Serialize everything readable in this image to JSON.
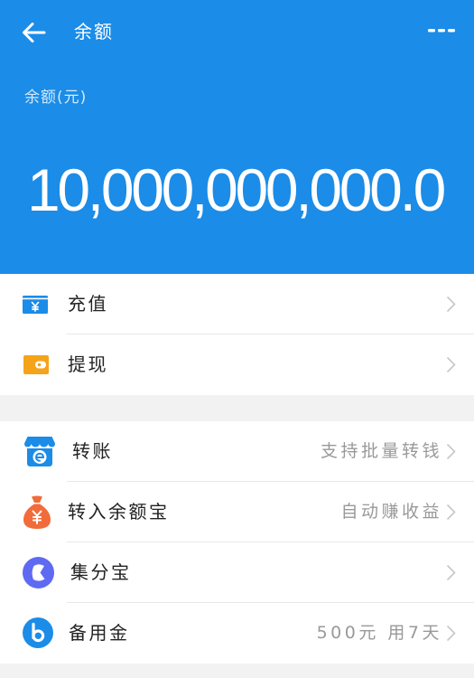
{
  "colors": {
    "primary": "#1B8CE7",
    "page_background": "#F2F2F2",
    "hint_text": "#999999"
  },
  "header": {
    "back_icon": "back-arrow-icon",
    "title": "余额",
    "more_icon": "more-dots-icon"
  },
  "balance": {
    "label": "余额(元)",
    "amount": "10,000,000,000.0"
  },
  "sections": [
    {
      "items": [
        {
          "label": "充值",
          "icon": "recharge-card-icon"
        },
        {
          "label": "提现",
          "icon": "withdraw-wallet-icon"
        }
      ]
    },
    {
      "items": [
        {
          "label": "转账",
          "hint": "支持批量转钱",
          "icon": "transfer-store-icon"
        },
        {
          "label": "转入余额宝",
          "hint": "自动赚收益",
          "icon": "money-bag-icon"
        },
        {
          "label": "集分宝",
          "icon": "jifenbao-icon"
        },
        {
          "label": "备用金",
          "hint": "500元 用7天",
          "icon": "beiyongjin-icon"
        }
      ]
    }
  ]
}
